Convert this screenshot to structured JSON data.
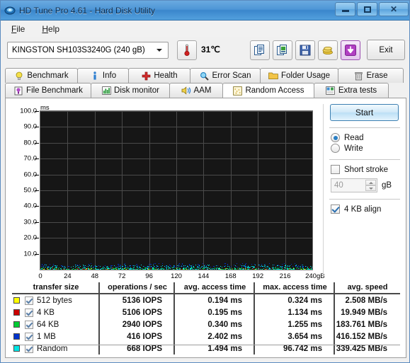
{
  "window": {
    "title": "HD Tune Pro 4.61 - Hard Disk Utility",
    "app_icon": "hdtune-icon",
    "minimize_label": "Minimize",
    "maximize_label": "Maximize",
    "close_label": "Close"
  },
  "menu": {
    "items": [
      {
        "label": "File",
        "accel": "F"
      },
      {
        "label": "Help",
        "accel": "H"
      }
    ]
  },
  "toolbar": {
    "drive": "KINGSTON SH103S3240G (240 gB)",
    "temperature": "31℃",
    "exit_label": "Exit",
    "buttons": [
      {
        "name": "copy-text-button",
        "icon": "copy-text-icon"
      },
      {
        "name": "copy-image-button",
        "icon": "copy-image-icon"
      },
      {
        "name": "save-button",
        "icon": "floppy-save-icon"
      },
      {
        "name": "donate-button",
        "icon": "coins-icon"
      },
      {
        "name": "download-button",
        "icon": "download-arrow-icon"
      }
    ]
  },
  "tabs": {
    "row1": [
      {
        "label": "Benchmark",
        "icon": "lightbulb-icon",
        "active": false
      },
      {
        "label": "Info",
        "icon": "info-icon",
        "active": false
      },
      {
        "label": "Health",
        "icon": "red-cross-icon",
        "active": false
      },
      {
        "label": "Error Scan",
        "icon": "magnifier-icon",
        "active": false
      },
      {
        "label": "Folder Usage",
        "icon": "folder-icon",
        "active": false
      },
      {
        "label": "Erase",
        "icon": "trash-icon",
        "active": false
      }
    ],
    "row2": [
      {
        "label": "File Benchmark",
        "icon": "file-benchmark-icon",
        "active": false
      },
      {
        "label": "Disk monitor",
        "icon": "bar-chart-icon",
        "active": false
      },
      {
        "label": "AAM",
        "icon": "speaker-icon",
        "active": false
      },
      {
        "label": "Random Access",
        "icon": "scatter-icon",
        "active": true
      },
      {
        "label": "Extra tests",
        "icon": "grid-chart-icon",
        "active": false
      }
    ]
  },
  "controls": {
    "start_label": "Start",
    "mode_options": [
      {
        "label": "Read",
        "selected": true
      },
      {
        "label": "Write",
        "selected": false
      }
    ],
    "short_stroke": {
      "label": "Short stroke",
      "checked": false
    },
    "short_stroke_size": {
      "value": "40",
      "unit": "gB",
      "enabled": false
    },
    "align": {
      "label": "4 KB align",
      "checked": true
    }
  },
  "chart_data": {
    "type": "scatter",
    "title": "",
    "xlabel": "",
    "ylabel": "ms",
    "xlim": [
      0,
      240
    ],
    "ylim": [
      0,
      100
    ],
    "xticks": [
      0,
      24,
      48,
      72,
      96,
      120,
      144,
      168,
      192,
      216,
      240
    ],
    "xtick_labels": [
      "0",
      "24",
      "48",
      "72",
      "96",
      "120",
      "144",
      "168",
      "192",
      "216",
      "240gB"
    ],
    "yticks": [
      10.0,
      20.0,
      30.0,
      40.0,
      50.0,
      60.0,
      70.0,
      80.0,
      90.0,
      100.0
    ],
    "ytick_labels": [
      "10.0",
      "20.0",
      "30.0",
      "40.0",
      "50.0",
      "60.0",
      "70.0",
      "80.0",
      "90.0",
      "100.0"
    ],
    "grid": true,
    "background": "#161616",
    "gridcolor": "#4a4a4a",
    "legend_position": "table-below",
    "series": [
      {
        "name": "512 bytes",
        "color": "#ffff00",
        "point_count": 90,
        "y_range": [
          0.1,
          0.9
        ]
      },
      {
        "name": "4 KB",
        "color": "#cc0000",
        "point_count": 90,
        "y_range": [
          0.1,
          1.4
        ]
      },
      {
        "name": "64 KB",
        "color": "#00cc33",
        "point_count": 240,
        "y_range": [
          0.2,
          1.6
        ]
      },
      {
        "name": "1 MB",
        "color": "#0033cc",
        "point_count": 200,
        "y_range": [
          2.0,
          4.2
        ]
      },
      {
        "name": "Random",
        "color": "#00e5e5",
        "point_count": 460,
        "y_range": [
          0.4,
          3.2
        ]
      }
    ]
  },
  "results_table": {
    "columns": [
      "transfer size",
      "operations / sec",
      "avg. access time",
      "max. access time",
      "avg. speed"
    ],
    "rows": [
      {
        "color": "#ffff00",
        "checked": true,
        "transfer_size": "512 bytes",
        "operations": "5136 IOPS",
        "avg_access": "0.194 ms",
        "max_access": "0.324 ms",
        "avg_speed": "2.508 MB/s"
      },
      {
        "color": "#cc0000",
        "checked": true,
        "transfer_size": "4 KB",
        "operations": "5106 IOPS",
        "avg_access": "0.195 ms",
        "max_access": "1.134 ms",
        "avg_speed": "19.949 MB/s"
      },
      {
        "color": "#00cc33",
        "checked": true,
        "transfer_size": "64 KB",
        "operations": "2940 IOPS",
        "avg_access": "0.340 ms",
        "max_access": "1.255 ms",
        "avg_speed": "183.761 MB/s"
      },
      {
        "color": "#0033cc",
        "checked": true,
        "transfer_size": "1 MB",
        "operations": "416 IOPS",
        "avg_access": "2.402 ms",
        "max_access": "3.654 ms",
        "avg_speed": "416.152 MB/s"
      },
      {
        "color": "#00e5e5",
        "checked": true,
        "transfer_size": "Random",
        "operations": "668 IOPS",
        "avg_access": "1.494 ms",
        "max_access": "96.742 ms",
        "avg_speed": "339.425 MB/s"
      }
    ]
  }
}
